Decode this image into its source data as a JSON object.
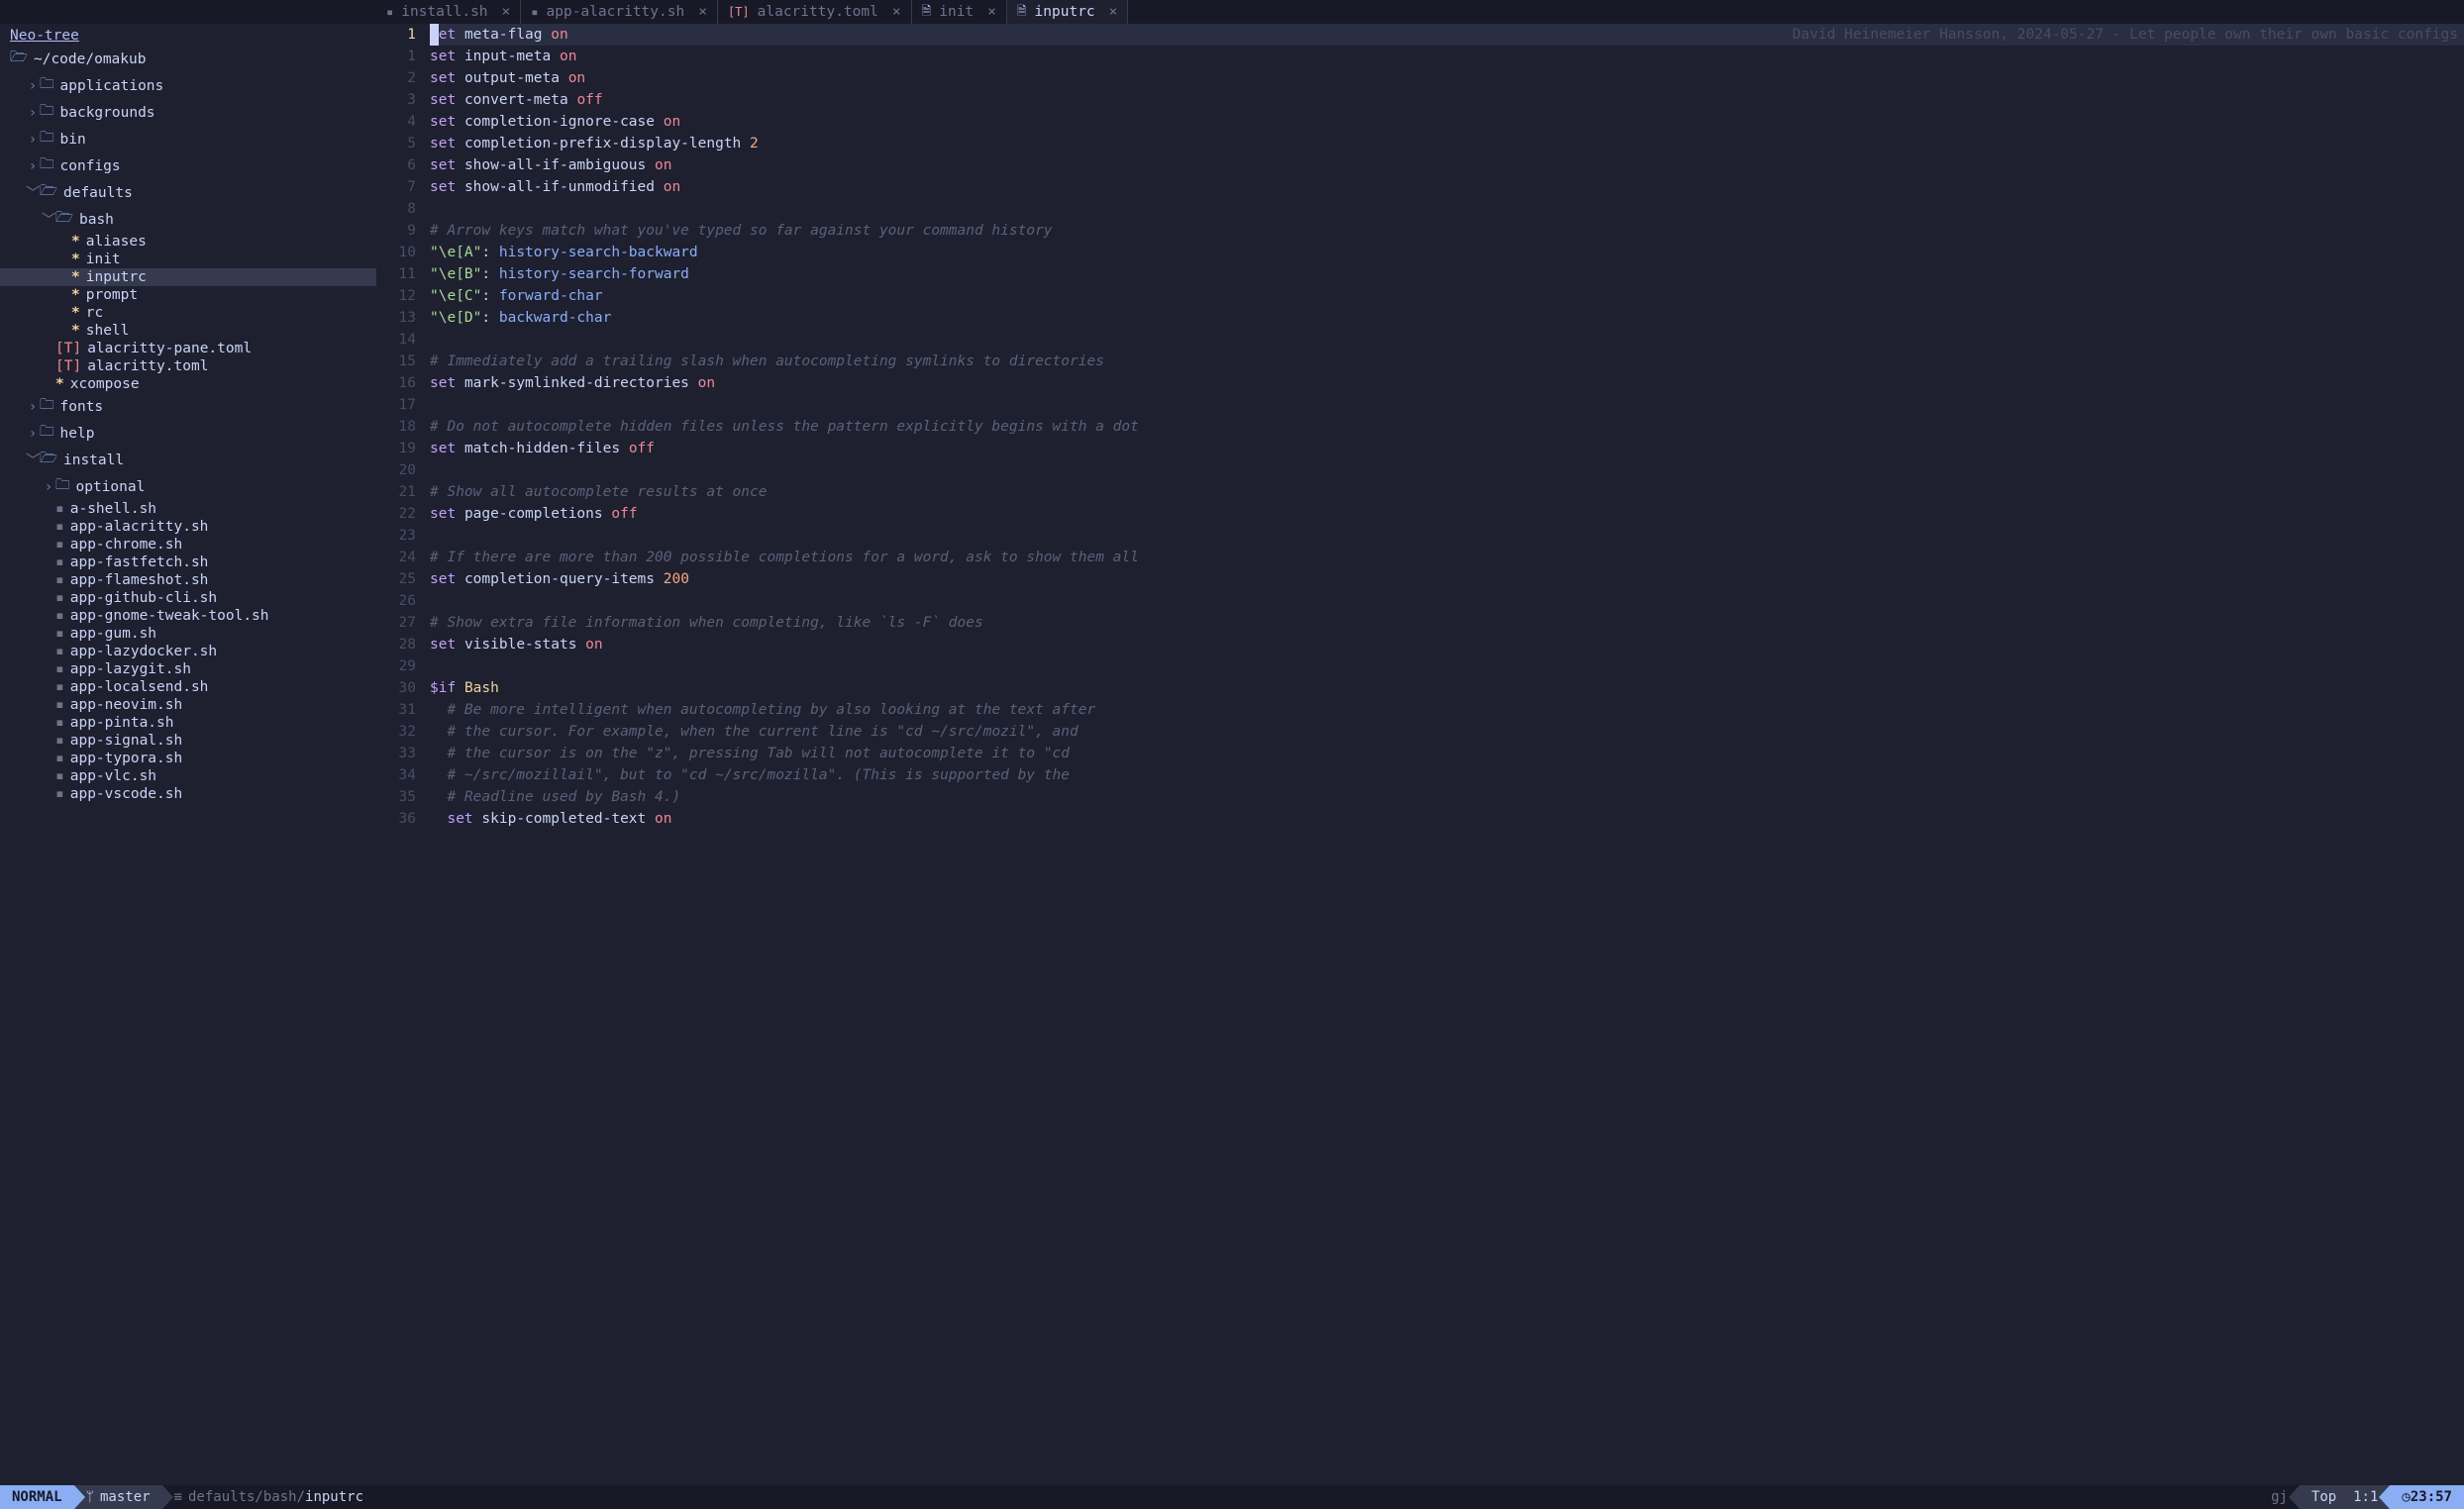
{
  "tabs": [
    {
      "label": "install.sh",
      "icon": "sh",
      "active": false
    },
    {
      "label": "app-alacritty.sh",
      "icon": "sh",
      "active": false
    },
    {
      "label": "alacritty.toml",
      "icon": "toml",
      "active": false
    },
    {
      "label": "init",
      "icon": "doc",
      "active": false
    },
    {
      "label": "inputrc",
      "icon": "doc",
      "active": true
    }
  ],
  "sidebar": {
    "title": "Neo-tree",
    "root_icon": "folder-open",
    "root_label": "~/code/omakub",
    "items": [
      {
        "depth": 1,
        "kind": "dir",
        "open": false,
        "label": "applications"
      },
      {
        "depth": 1,
        "kind": "dir",
        "open": false,
        "label": "backgrounds"
      },
      {
        "depth": 1,
        "kind": "dir",
        "open": false,
        "label": "bin"
      },
      {
        "depth": 1,
        "kind": "dir",
        "open": false,
        "label": "configs"
      },
      {
        "depth": 1,
        "kind": "dir",
        "open": true,
        "label": "defaults"
      },
      {
        "depth": 2,
        "kind": "dir",
        "open": true,
        "label": "bash"
      },
      {
        "depth": 3,
        "kind": "star",
        "label": "aliases"
      },
      {
        "depth": 3,
        "kind": "star",
        "label": "init"
      },
      {
        "depth": 3,
        "kind": "star",
        "label": "inputrc",
        "selected": true
      },
      {
        "depth": 3,
        "kind": "star",
        "label": "prompt"
      },
      {
        "depth": 3,
        "kind": "star",
        "label": "rc"
      },
      {
        "depth": 3,
        "kind": "star",
        "label": "shell"
      },
      {
        "depth": 2,
        "kind": "toml",
        "label": "alacritty-pane.toml"
      },
      {
        "depth": 2,
        "kind": "toml",
        "label": "alacritty.toml"
      },
      {
        "depth": 2,
        "kind": "star",
        "label": "xcompose"
      },
      {
        "depth": 1,
        "kind": "dir",
        "open": false,
        "label": "fonts"
      },
      {
        "depth": 1,
        "kind": "dir",
        "open": false,
        "label": "help"
      },
      {
        "depth": 1,
        "kind": "dir",
        "open": true,
        "label": "install"
      },
      {
        "depth": 2,
        "kind": "dir",
        "open": false,
        "label": "optional"
      },
      {
        "depth": 2,
        "kind": "file",
        "label": "a-shell.sh"
      },
      {
        "depth": 2,
        "kind": "file",
        "label": "app-alacritty.sh"
      },
      {
        "depth": 2,
        "kind": "file",
        "label": "app-chrome.sh"
      },
      {
        "depth": 2,
        "kind": "file",
        "label": "app-fastfetch.sh"
      },
      {
        "depth": 2,
        "kind": "file",
        "label": "app-flameshot.sh"
      },
      {
        "depth": 2,
        "kind": "file",
        "label": "app-github-cli.sh"
      },
      {
        "depth": 2,
        "kind": "file",
        "label": "app-gnome-tweak-tool.sh"
      },
      {
        "depth": 2,
        "kind": "file",
        "label": "app-gum.sh"
      },
      {
        "depth": 2,
        "kind": "file",
        "label": "app-lazydocker.sh"
      },
      {
        "depth": 2,
        "kind": "file",
        "label": "app-lazygit.sh"
      },
      {
        "depth": 2,
        "kind": "file",
        "label": "app-localsend.sh"
      },
      {
        "depth": 2,
        "kind": "file",
        "label": "app-neovim.sh"
      },
      {
        "depth": 2,
        "kind": "file",
        "label": "app-pinta.sh"
      },
      {
        "depth": 2,
        "kind": "file",
        "label": "app-signal.sh"
      },
      {
        "depth": 2,
        "kind": "file",
        "label": "app-typora.sh"
      },
      {
        "depth": 2,
        "kind": "file",
        "label": "app-vlc.sh"
      },
      {
        "depth": 2,
        "kind": "file",
        "label": "app-vscode.sh"
      }
    ]
  },
  "editor": {
    "inlay": "David Heinemeier Hansson, 2024-05-27 - Let people own their own basic configs",
    "lines": [
      {
        "n": "1",
        "active": true,
        "t": [
          [
            "kw",
            "set"
          ],
          [
            "sp",
            " "
          ],
          [
            "ident",
            "meta-flag"
          ],
          [
            "sp",
            " "
          ],
          [
            "val-on",
            "on"
          ]
        ]
      },
      {
        "n": "1",
        "t": [
          [
            "kw",
            "set"
          ],
          [
            "sp",
            " "
          ],
          [
            "ident",
            "input-meta"
          ],
          [
            "sp",
            " "
          ],
          [
            "val-on",
            "on"
          ]
        ]
      },
      {
        "n": "2",
        "t": [
          [
            "kw",
            "set"
          ],
          [
            "sp",
            " "
          ],
          [
            "ident",
            "output-meta"
          ],
          [
            "sp",
            " "
          ],
          [
            "val-on",
            "on"
          ]
        ]
      },
      {
        "n": "3",
        "t": [
          [
            "kw",
            "set"
          ],
          [
            "sp",
            " "
          ],
          [
            "ident",
            "convert-meta"
          ],
          [
            "sp",
            " "
          ],
          [
            "val-off",
            "off"
          ]
        ]
      },
      {
        "n": "4",
        "t": [
          [
            "kw",
            "set"
          ],
          [
            "sp",
            " "
          ],
          [
            "ident",
            "completion-ignore-case"
          ],
          [
            "sp",
            " "
          ],
          [
            "val-on",
            "on"
          ]
        ]
      },
      {
        "n": "5",
        "t": [
          [
            "kw",
            "set"
          ],
          [
            "sp",
            " "
          ],
          [
            "ident",
            "completion-prefix-display-length"
          ],
          [
            "sp",
            " "
          ],
          [
            "num",
            "2"
          ]
        ]
      },
      {
        "n": "6",
        "t": [
          [
            "kw",
            "set"
          ],
          [
            "sp",
            " "
          ],
          [
            "ident",
            "show-all-if-ambiguous"
          ],
          [
            "sp",
            " "
          ],
          [
            "val-on",
            "on"
          ]
        ]
      },
      {
        "n": "7",
        "t": [
          [
            "kw",
            "set"
          ],
          [
            "sp",
            " "
          ],
          [
            "ident",
            "show-all-if-unmodified"
          ],
          [
            "sp",
            " "
          ],
          [
            "val-on",
            "on"
          ]
        ]
      },
      {
        "n": "8",
        "t": []
      },
      {
        "n": "9",
        "t": [
          [
            "comment",
            "# Arrow keys match what you've typed so far against your command history"
          ]
        ]
      },
      {
        "n": "10",
        "t": [
          [
            "str",
            "\"\\e[A\""
          ],
          [
            "ident",
            ": "
          ],
          [
            "func",
            "history-search-backward"
          ]
        ]
      },
      {
        "n": "11",
        "t": [
          [
            "str",
            "\"\\e[B\""
          ],
          [
            "ident",
            ": "
          ],
          [
            "func",
            "history-search-forward"
          ]
        ]
      },
      {
        "n": "12",
        "t": [
          [
            "str",
            "\"\\e[C\""
          ],
          [
            "ident",
            ": "
          ],
          [
            "func",
            "forward-char"
          ]
        ]
      },
      {
        "n": "13",
        "t": [
          [
            "str",
            "\"\\e[D\""
          ],
          [
            "ident",
            ": "
          ],
          [
            "func",
            "backward-char"
          ]
        ]
      },
      {
        "n": "14",
        "t": []
      },
      {
        "n": "15",
        "t": [
          [
            "comment",
            "# Immediately add a trailing slash when autocompleting symlinks to directories"
          ]
        ]
      },
      {
        "n": "16",
        "t": [
          [
            "kw",
            "set"
          ],
          [
            "sp",
            " "
          ],
          [
            "ident",
            "mark-symlinked-directories"
          ],
          [
            "sp",
            " "
          ],
          [
            "val-on",
            "on"
          ]
        ]
      },
      {
        "n": "17",
        "t": []
      },
      {
        "n": "18",
        "t": [
          [
            "comment",
            "# Do not autocomplete hidden files unless the pattern explicitly begins with a dot"
          ]
        ]
      },
      {
        "n": "19",
        "t": [
          [
            "kw",
            "set"
          ],
          [
            "sp",
            " "
          ],
          [
            "ident",
            "match-hidden-files"
          ],
          [
            "sp",
            " "
          ],
          [
            "val-off",
            "off"
          ]
        ]
      },
      {
        "n": "20",
        "t": []
      },
      {
        "n": "21",
        "t": [
          [
            "comment",
            "# Show all autocomplete results at once"
          ]
        ]
      },
      {
        "n": "22",
        "t": [
          [
            "kw",
            "set"
          ],
          [
            "sp",
            " "
          ],
          [
            "ident",
            "page-completions"
          ],
          [
            "sp",
            " "
          ],
          [
            "val-off",
            "off"
          ]
        ]
      },
      {
        "n": "23",
        "t": []
      },
      {
        "n": "24",
        "t": [
          [
            "comment",
            "# If there are more than 200 possible completions for a word, ask to show them all"
          ]
        ]
      },
      {
        "n": "25",
        "t": [
          [
            "kw",
            "set"
          ],
          [
            "sp",
            " "
          ],
          [
            "ident",
            "completion-query-items"
          ],
          [
            "sp",
            " "
          ],
          [
            "num",
            "200"
          ]
        ]
      },
      {
        "n": "26",
        "t": []
      },
      {
        "n": "27",
        "t": [
          [
            "comment",
            "# Show extra file information when completing, like `ls -F` does"
          ]
        ]
      },
      {
        "n": "28",
        "t": [
          [
            "kw",
            "set"
          ],
          [
            "sp",
            " "
          ],
          [
            "ident",
            "visible-stats"
          ],
          [
            "sp",
            " "
          ],
          [
            "val-on",
            "on"
          ]
        ]
      },
      {
        "n": "29",
        "t": []
      },
      {
        "n": "30",
        "t": [
          [
            "kw",
            "$if"
          ],
          [
            "sp",
            " "
          ],
          [
            "class",
            "Bash"
          ]
        ]
      },
      {
        "n": "31",
        "t": [
          [
            "sp",
            "  "
          ],
          [
            "comment",
            "# Be more intelligent when autocompleting by also looking at the text after"
          ]
        ]
      },
      {
        "n": "32",
        "t": [
          [
            "sp",
            "  "
          ],
          [
            "comment",
            "# the cursor. For example, when the current line is \"cd ~/src/mozil\", and"
          ]
        ]
      },
      {
        "n": "33",
        "t": [
          [
            "sp",
            "  "
          ],
          [
            "comment",
            "# the cursor is on the \"z\", pressing Tab will not autocomplete it to \"cd"
          ]
        ]
      },
      {
        "n": "34",
        "t": [
          [
            "sp",
            "  "
          ],
          [
            "comment",
            "# ~/src/mozillail\", but to \"cd ~/src/mozilla\". (This is supported by the"
          ]
        ]
      },
      {
        "n": "35",
        "t": [
          [
            "sp",
            "  "
          ],
          [
            "comment",
            "# Readline used by Bash 4.)"
          ]
        ]
      },
      {
        "n": "36",
        "t": [
          [
            "sp",
            "  "
          ],
          [
            "kw",
            "set"
          ],
          [
            "sp",
            " "
          ],
          [
            "ident",
            "skip-completed-text"
          ],
          [
            "sp",
            " "
          ],
          [
            "val-on",
            "on"
          ]
        ]
      }
    ]
  },
  "status": {
    "mode": "NORMAL",
    "branch": "master",
    "path_dir": "defaults/bash/",
    "path_file": "inputrc",
    "keys": "gj",
    "scroll": "Top",
    "pos": "1:1",
    "clock": "23:57"
  }
}
